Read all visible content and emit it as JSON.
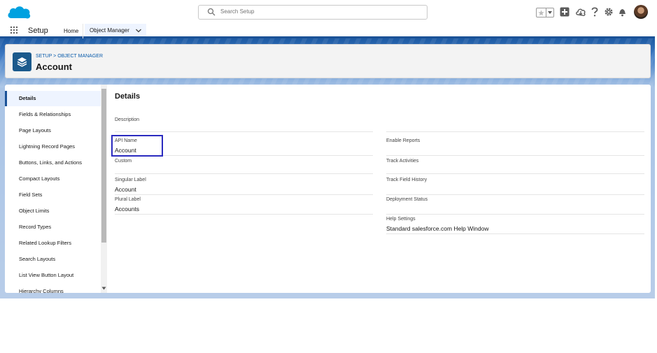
{
  "header": {
    "search_placeholder": "Search Setup",
    "icons": [
      "favorites-star-icon",
      "favorites-dropdown-icon",
      "global-actions-icon",
      "trailhead-icon",
      "help-icon",
      "setup-gear-icon",
      "notifications-bell-icon",
      "user-avatar"
    ]
  },
  "nav": {
    "app_name": "Setup",
    "tabs": [
      "Home",
      "Object Manager"
    ]
  },
  "object": {
    "breadcrumb": "SETUP > OBJECT MANAGER",
    "title": "Account"
  },
  "sidebar": {
    "items": [
      "Details",
      "Fields & Relationships",
      "Page Layouts",
      "Lightning Record Pages",
      "Buttons, Links, and Actions",
      "Compact Layouts",
      "Field Sets",
      "Object Limits",
      "Record Types",
      "Related Lookup Filters",
      "Search Layouts",
      "List View Button Layout",
      "Hierarchy Columns"
    ],
    "active": "Details"
  },
  "details": {
    "title": "Details",
    "left": {
      "description_label": "Description",
      "api_name_label": "API Name",
      "api_name_value": "Account",
      "custom_label": "Custom",
      "singular_label_label": "Singular Label",
      "singular_label_value": "Account",
      "plural_label_label": "Plural Label",
      "plural_label_value": "Accounts"
    },
    "right": {
      "enable_reports_label": "Enable Reports",
      "track_activities_label": "Track Activities",
      "track_field_history_label": "Track Field History",
      "deployment_status_label": "Deployment Status",
      "help_settings_label": "Help Settings",
      "help_settings_value": "Standard salesforce.com Help Window"
    }
  },
  "colors": {
    "brand_blue": "#1b5297",
    "link_blue": "#0b5cab",
    "cloud_blue": "#00a1e0",
    "highlight_box": "#2b2bbf"
  }
}
